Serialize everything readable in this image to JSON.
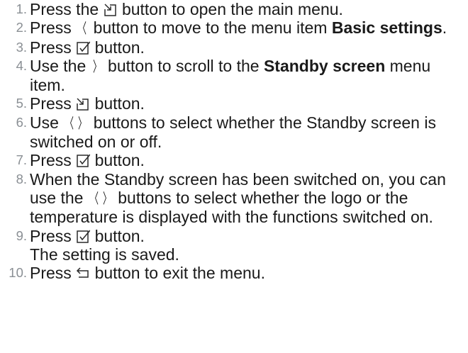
{
  "steps": [
    {
      "n": "1.",
      "pre": "Press the",
      "post": "button to open the main menu."
    },
    {
      "n": "2.",
      "pre": "Press",
      "mid": "button to move to the menu item",
      "bold": "Basic settings",
      "post": "."
    },
    {
      "n": "3.",
      "pre": "Press",
      "post": "button."
    },
    {
      "n": "4.",
      "pre": "Use the",
      "mid": "button to scroll to the",
      "bold": "Standby screen",
      "post": "menu item."
    },
    {
      "n": "5.",
      "pre": "Press",
      "post": "button."
    },
    {
      "n": "6.",
      "pre": "Use",
      "post": "buttons to select whether the Standby screen is switched on or off."
    },
    {
      "n": "7.",
      "pre": "Press",
      "post": "button."
    },
    {
      "n": "8.",
      "pre": "When the Standby screen has been switched on, you can use the",
      "post": "buttons to select whether the logo or the temperature is displayed with the functions switched on."
    },
    {
      "n": "9.",
      "pre": "Press",
      "post": "button.",
      "line2": "The setting is saved."
    },
    {
      "n": "10.",
      "pre": "Press",
      "post": "button to exit the menu."
    }
  ],
  "glyphs": {
    "left": "〈",
    "right": "〉"
  },
  "icons": {
    "menu": "menu-enter-icon",
    "confirm": "checkbox-confirm-icon",
    "back": "back-arrow-icon"
  }
}
